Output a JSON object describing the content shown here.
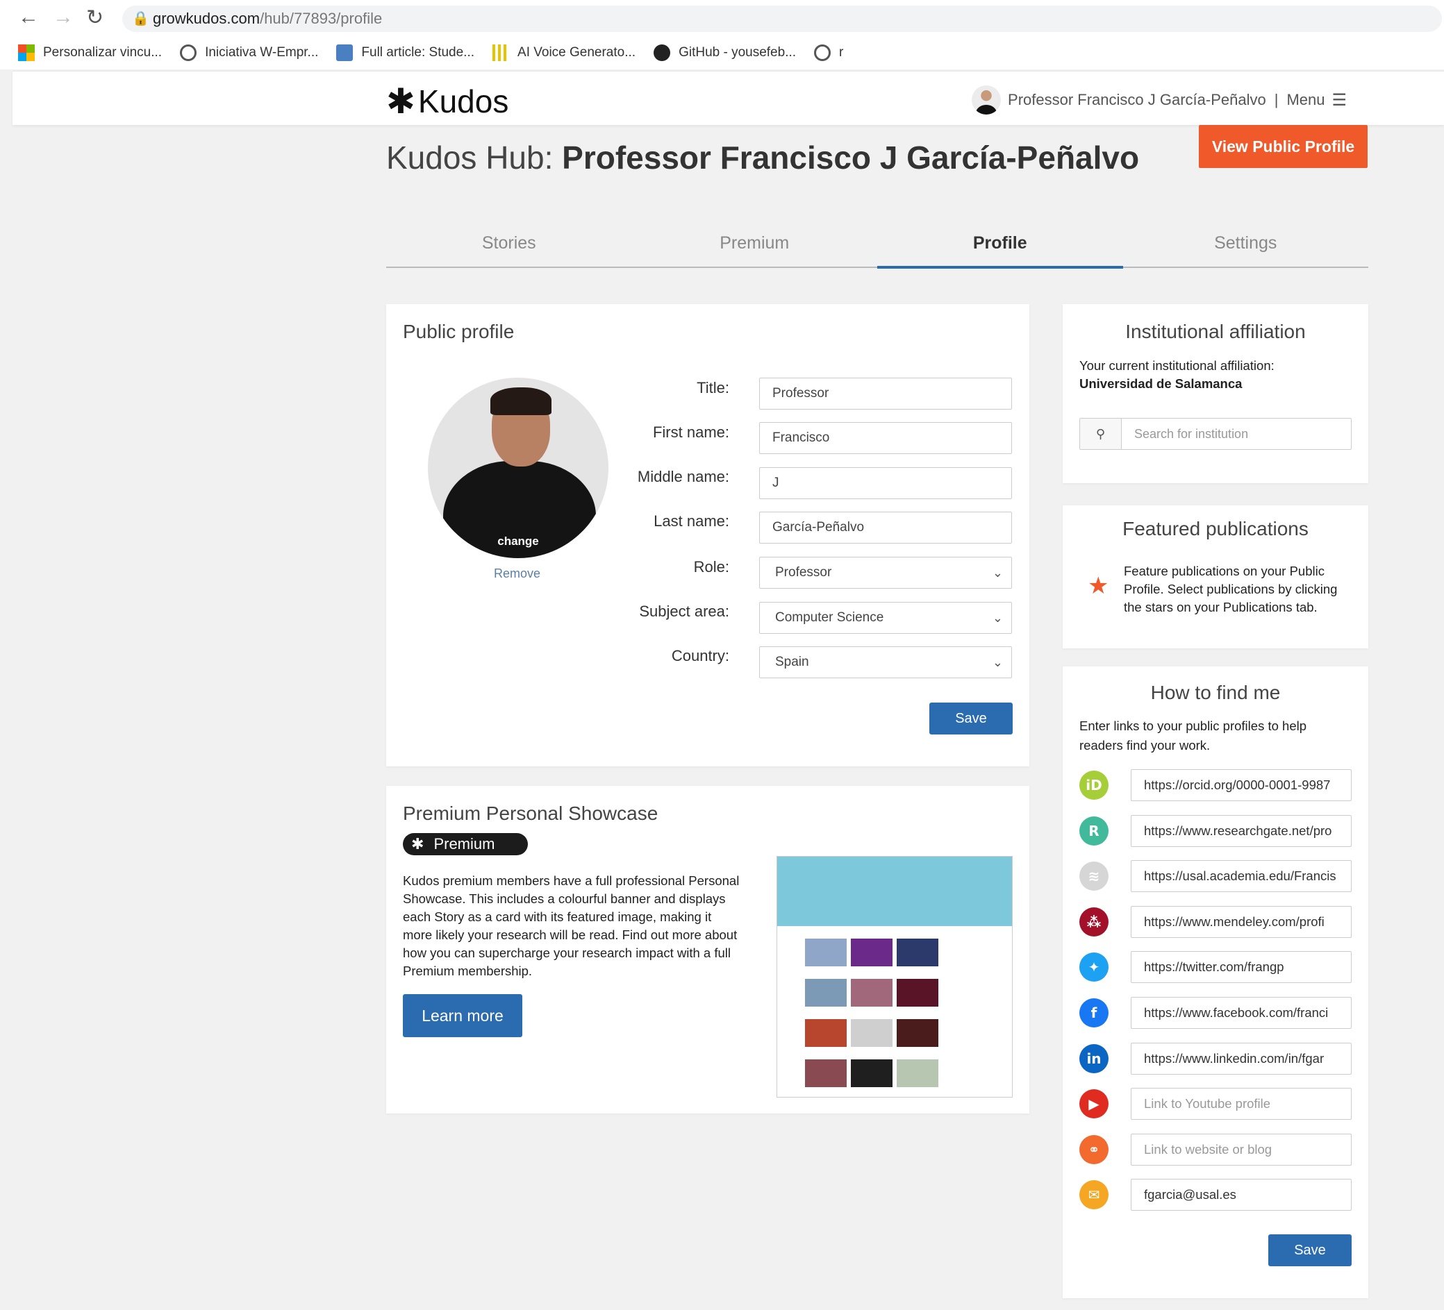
{
  "browser": {
    "url_host": "growkudos.com",
    "url_path": "/hub/77893/profile",
    "bookmarks": [
      {
        "label": "Personalizar vincu...",
        "icon": "windows-icon"
      },
      {
        "label": "Iniciativa W-Empr...",
        "icon": "globe-icon"
      },
      {
        "label": "Full article: Stude...",
        "icon": "article-icon"
      },
      {
        "label": "AI Voice Generato...",
        "icon": "voice-icon"
      },
      {
        "label": "GitHub - yousefeb...",
        "icon": "github-icon"
      },
      {
        "label": "r",
        "icon": "globe-icon"
      }
    ]
  },
  "header": {
    "logo": "Kudos",
    "user_name": "Professor Francisco J García-Peñalvo",
    "separator": "|",
    "menu_label": "Menu"
  },
  "page": {
    "title_prefix": "Kudos Hub: ",
    "title_name": "Professor Francisco J García-Peñalvo",
    "view_public_label": "View Public Profile"
  },
  "tabs": [
    {
      "label": "Stories",
      "active": false
    },
    {
      "label": "Premium",
      "active": false
    },
    {
      "label": "Profile",
      "active": true
    },
    {
      "label": "Settings",
      "active": false
    }
  ],
  "public_profile": {
    "heading": "Public profile",
    "photo_change": "change",
    "photo_remove": "Remove",
    "fields": {
      "title": {
        "label": "Title:",
        "value": "Professor"
      },
      "first_name": {
        "label": "First name:",
        "value": "Francisco"
      },
      "middle_name": {
        "label": "Middle name:",
        "value": "J"
      },
      "last_name": {
        "label": "Last name:",
        "value": "García-Peñalvo"
      },
      "role": {
        "label": "Role:",
        "value": "Professor"
      },
      "subject_area": {
        "label": "Subject area:",
        "value": "Computer Science"
      },
      "country": {
        "label": "Country:",
        "value": "Spain"
      }
    },
    "save_label": "Save"
  },
  "showcase": {
    "heading": "Premium Personal Showcase",
    "badge": "Premium",
    "description": "Kudos premium members have a full professional Personal Showcase. This includes a colourful banner and displays each Story as a card with its featured image, making it more likely your research will be read. Find out more about how you can supercharge your research impact with a full Premium membership.",
    "learn_more_label": "Learn more"
  },
  "affiliation": {
    "heading": "Institutional affiliation",
    "current_label": "Your current institutional affiliation:",
    "current_value": "Universidad de Salamanca",
    "search_placeholder": "Search for institution"
  },
  "featured": {
    "heading": "Featured publications",
    "text": "Feature publications on your Public Profile. Select publications by clicking the stars on your Publications tab."
  },
  "find_me": {
    "heading": "How to find me",
    "text": "Enter links to your public profiles to help readers find your work.",
    "links": [
      {
        "icon": "orcid-icon",
        "color": "#a6ce39",
        "glyph": "iD",
        "value": "https://orcid.org/0000-0001-9987",
        "placeholder": false
      },
      {
        "icon": "researchgate-icon",
        "color": "#40ba9b",
        "glyph": "R",
        "value": "https://www.researchgate.net/pro",
        "placeholder": false
      },
      {
        "icon": "academia-icon",
        "color": "#d6d6d6",
        "glyph": "≋",
        "value": "https://usal.academia.edu/Francis",
        "placeholder": false
      },
      {
        "icon": "mendeley-icon",
        "color": "#a3102a",
        "glyph": "⁂",
        "value": "https://www.mendeley.com/profi",
        "placeholder": false
      },
      {
        "icon": "twitter-icon",
        "color": "#1da1f2",
        "glyph": "✦",
        "value": "https://twitter.com/frangp",
        "placeholder": false
      },
      {
        "icon": "facebook-icon",
        "color": "#1877f2",
        "glyph": "f",
        "value": "https://www.facebook.com/franci",
        "placeholder": false
      },
      {
        "icon": "linkedin-icon",
        "color": "#0a66c2",
        "glyph": "in",
        "value": "https://www.linkedin.com/in/fgar",
        "placeholder": false
      },
      {
        "icon": "youtube-icon",
        "color": "#e02b20",
        "glyph": "▶",
        "value": "Link to Youtube profile",
        "placeholder": true
      },
      {
        "icon": "website-link-icon",
        "color": "#f26a2e",
        "glyph": "⚭",
        "value": "Link to website or blog",
        "placeholder": true
      },
      {
        "icon": "email-icon",
        "color": "#f5a623",
        "glyph": "✉",
        "value": "fgarcia@usal.es",
        "placeholder": false
      }
    ],
    "save_label": "Save"
  }
}
